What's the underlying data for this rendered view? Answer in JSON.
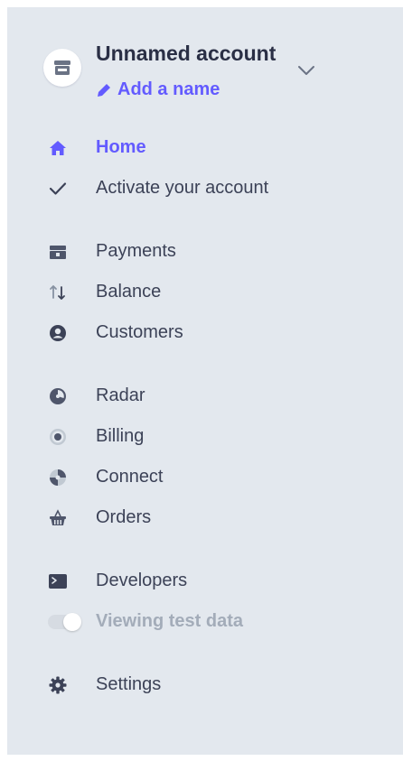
{
  "account": {
    "name": "Unnamed account",
    "add_name_label": "Add a name",
    "avatar_icon": "store-icon",
    "chevron_icon": "chevron-down-icon"
  },
  "nav": {
    "home": {
      "label": "Home",
      "icon": "home-icon"
    },
    "activate": {
      "label": "Activate your account",
      "icon": "checkmark-icon"
    },
    "payments": {
      "label": "Payments",
      "icon": "payments-icon"
    },
    "balance": {
      "label": "Balance",
      "icon": "balance-arrows-icon"
    },
    "customers": {
      "label": "Customers",
      "icon": "customers-icon"
    },
    "radar": {
      "label": "Radar",
      "icon": "radar-icon"
    },
    "billing": {
      "label": "Billing",
      "icon": "billing-icon"
    },
    "connect": {
      "label": "Connect",
      "icon": "connect-icon"
    },
    "orders": {
      "label": "Orders",
      "icon": "orders-basket-icon"
    },
    "developers": {
      "label": "Developers",
      "icon": "terminal-icon"
    },
    "test_data": {
      "label": "Viewing test data",
      "toggle_on": false
    },
    "settings": {
      "label": "Settings",
      "icon": "gear-icon"
    }
  },
  "colors": {
    "accent": "#635bff",
    "sidebar_bg": "#e3e8ee",
    "text": "#3c4257",
    "muted": "#a3acb9"
  }
}
